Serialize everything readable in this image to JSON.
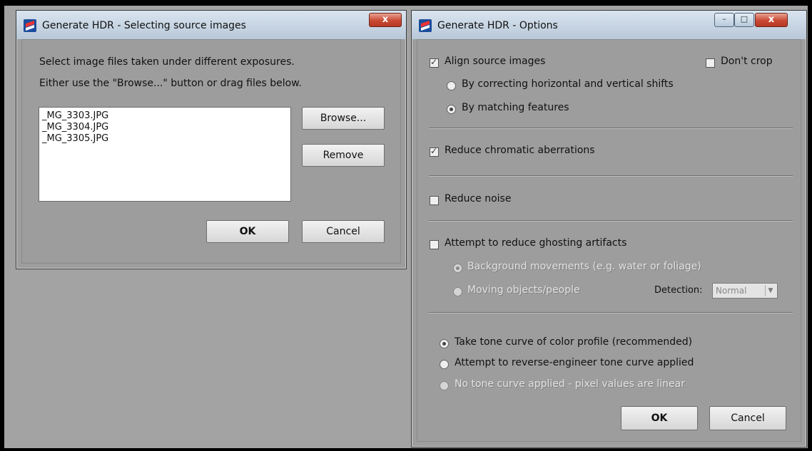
{
  "window1": {
    "title": "Generate HDR - Selecting source images",
    "close_label": "x",
    "instruction1": "Select image files taken under different exposures.",
    "instruction2": "Either use the \"Browse...\" button or drag files below.",
    "files": [
      "_MG_3303.JPG",
      "_MG_3304.JPG",
      "_MG_3305.JPG"
    ],
    "browse_label": "Browse...",
    "remove_label": "Remove",
    "ok_label": "OK",
    "cancel_label": "Cancel"
  },
  "window2": {
    "title": "Generate HDR - Options",
    "minimize_label": "–",
    "maximize_label": "□",
    "close_label": "x",
    "align_label": "Align source images",
    "align_checked": true,
    "dont_crop_label": "Don't crop",
    "dont_crop_checked": false,
    "align_shift_label": "By correcting horizontal and vertical shifts",
    "align_features_label": "By matching features",
    "align_method_selected": "By matching features",
    "chromatic_label": "Reduce chromatic aberrations",
    "chromatic_checked": true,
    "noise_label": "Reduce noise",
    "noise_checked": false,
    "ghost_label": "Attempt to reduce ghosting artifacts",
    "ghost_checked": false,
    "ghost_bg_label": "Background movements (e.g. water or foliage)",
    "ghost_objects_label": "Moving objects/people",
    "detection_label": "Detection:",
    "detection_value": "Normal",
    "tone_profile_label": "Take tone curve of color profile (recommended)",
    "tone_reverse_label": "Attempt to reverse-engineer tone curve applied",
    "tone_linear_label": "No tone curve applied - pixel values are linear",
    "tone_selected": "Take tone curve of color profile (recommended)",
    "ok_label": "OK",
    "cancel_label": "Cancel"
  }
}
